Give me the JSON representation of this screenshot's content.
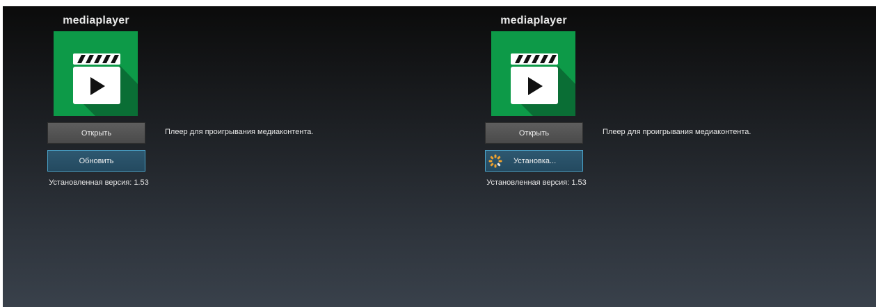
{
  "apps": [
    {
      "title": "mediaplayer",
      "icon": "media-player-clapperboard-play-icon",
      "open_label": "Открыть",
      "action_label": "Обновить",
      "action_state": "update",
      "version_text": "Установленная версия: 1.53",
      "description": "Плеер для проигрывания медиаконтента."
    },
    {
      "title": "mediaplayer",
      "icon": "media-player-clapperboard-play-icon",
      "open_label": "Открыть",
      "action_label": "Установка...",
      "action_state": "installing",
      "version_text": "Установленная версия: 1.53",
      "description": "Плеер для проигрывания медиаконтента."
    }
  ],
  "colors": {
    "icon_green": "#0d9a48",
    "icon_shadow": "#0a6e35",
    "update_border": "#4aa3c9",
    "spinner_orange": "#f0a32e"
  }
}
